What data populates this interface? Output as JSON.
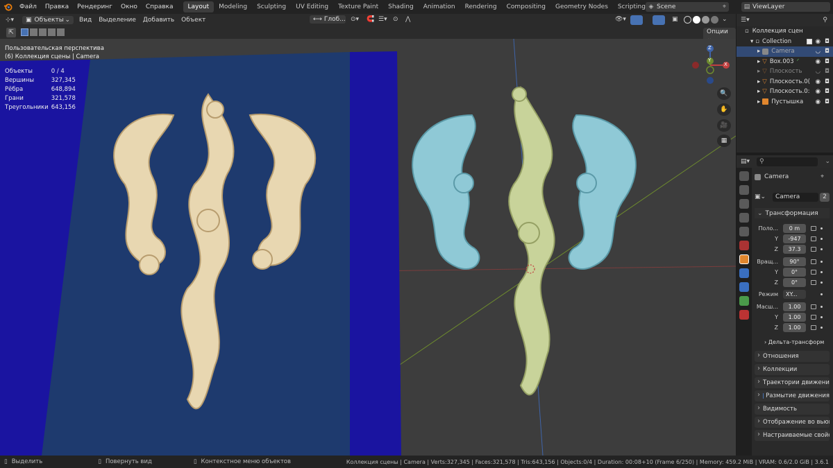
{
  "menu": {
    "items": [
      "Файл",
      "Правка",
      "Рендеринг",
      "Окно",
      "Справка"
    ]
  },
  "workspaces": [
    "Layout",
    "Modeling",
    "Sculpting",
    "UV Editing",
    "Texture Paint",
    "Shading",
    "Animation",
    "Rendering",
    "Compositing",
    "Geometry Nodes",
    "Scripting"
  ],
  "scene": "Scene",
  "view_layer": "ViewLayer",
  "viewport_header": {
    "mode": "Объекты",
    "menus": [
      "Вид",
      "Выделение",
      "Добавить",
      "Объект"
    ],
    "orientation": "Глоб...",
    "options": "Опции"
  },
  "overlay": {
    "view_name": "Пользовательская перспектива",
    "collection_line": "(6) Коллекция сцены | Camera",
    "stats": [
      {
        "label": "Объекты",
        "value": "0 / 4"
      },
      {
        "label": "Вершины",
        "value": "327,345"
      },
      {
        "label": "Рёбра",
        "value": "648,894"
      },
      {
        "label": "Грани",
        "value": "321,578"
      },
      {
        "label": "Треугольники",
        "value": "643,156"
      }
    ]
  },
  "gizmo": {
    "z": "Z",
    "y": "Y",
    "x": "X"
  },
  "outliner": {
    "root": "Коллекция сцен",
    "items": [
      {
        "label": "Collection",
        "depth": 1,
        "dim": false
      },
      {
        "label": "Camera",
        "depth": 2,
        "dim": false,
        "selected": true
      },
      {
        "label": "Box.003",
        "depth": 1,
        "dim": false
      },
      {
        "label": "Плоскость",
        "depth": 1,
        "dim": true
      },
      {
        "label": "Плоскость.0(",
        "depth": 1,
        "dim": false
      },
      {
        "label": "Плоскость.0:",
        "depth": 1,
        "dim": false
      },
      {
        "label": "Пустышка",
        "depth": 1,
        "dim": false
      }
    ]
  },
  "properties": {
    "object_name": "Camera",
    "data_name": "Camera",
    "users": "2",
    "transform_title": "Трансформация",
    "location": {
      "label": "Поло...",
      "x": "0 m",
      "y": "-947",
      "z": "37.3"
    },
    "rotation": {
      "label": "Вращ...",
      "x": "90°",
      "y": "0°",
      "z": "0°"
    },
    "mode": {
      "label": "Режим",
      "value": "XY..."
    },
    "scale": {
      "label": "Масш...",
      "x": "1.00",
      "y": "1.00",
      "z": "1.00"
    },
    "axis": {
      "y": "Y",
      "z": "Z"
    },
    "delta": "Дельта-трансформ",
    "panels": [
      "Отношения",
      "Коллекции",
      "Траектории движения",
      "Размытие движения",
      "Видимость",
      "Отображение во вьюпо",
      "Настраиваемые свойства"
    ]
  },
  "statusbar": {
    "select": "Выделить",
    "rotate": "Повернуть вид",
    "context": "Контекстное меню объектов",
    "info": "Коллекция сцены | Camera | Verts:327,345 | Faces:321,578 | Tris:643,156 | Objects:0/4 | Duration: 00:08+10 (Frame 6/250) | Memory: 459.2 MiB | VRAM: 0.6/2.0 GiB | 3.6.1"
  },
  "colors": {
    "accent": "#4772b3",
    "blue_bg": "#1a14a0",
    "wood": "#e8d7b1",
    "teal": "#8fc9d6",
    "olive": "#c8d39a",
    "grid": "#3d3d3d"
  }
}
